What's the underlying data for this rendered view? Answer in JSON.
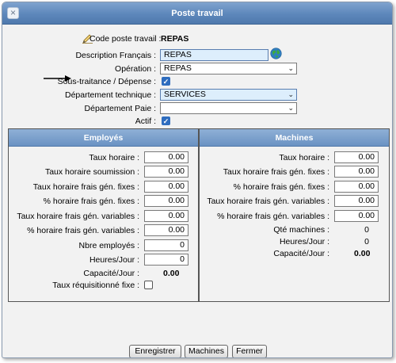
{
  "window": {
    "title": "Poste travail",
    "close_glyph": "×"
  },
  "form": {
    "code_label": "Code poste travail :",
    "code_value": "REPAS",
    "description_label": "Description Français :",
    "description_value": "REPAS",
    "operation_label": "Opération :",
    "operation_value": "REPAS",
    "soustraitance_label": "Sous-traitance / Dépense :",
    "soustraitance_checked": true,
    "dept_tech_label": "Département technique :",
    "dept_tech_value": "SERVICES",
    "dept_paie_label": "Département Paie :",
    "dept_paie_value": "",
    "actif_label": "Actif :",
    "actif_checked": true
  },
  "icons": {
    "edit": "pencil-icon",
    "globe": "globe-icon",
    "arrow": "arrow-right-icon",
    "chevron": "chevron-down-icon"
  },
  "employes": {
    "title": "Employés",
    "taux_horaire_label": "Taux horaire :",
    "taux_horaire_value": "0.00",
    "taux_soum_label": "Taux horaire soumission :",
    "taux_soum_value": "0.00",
    "fixes_label": "Taux horaire frais gén. fixes :",
    "fixes_value": "0.00",
    "pct_fixes_label": "% horaire frais gén. fixes :",
    "pct_fixes_value": "0.00",
    "variables_label": "Taux horaire frais gén. variables :",
    "variables_value": "0.00",
    "pct_variables_label": "% horaire frais gén. variables :",
    "pct_variables_value": "0.00",
    "nbre_label": "Nbre employés :",
    "nbre_value": "0",
    "heures_label": "Heures/Jour :",
    "heures_value": "0",
    "capacite_label": "Capacité/Jour :",
    "capacite_value": "0.00",
    "requisition_label": "Taux réquisitionné fixe :",
    "requisition_checked": false
  },
  "machines": {
    "title": "Machines",
    "taux_horaire_label": "Taux horaire :",
    "taux_horaire_value": "0.00",
    "fixes_label": "Taux horaire frais gén. fixes :",
    "fixes_value": "0.00",
    "pct_fixes_label": "% horaire frais gén. fixes :",
    "pct_fixes_value": "0.00",
    "variables_label": "Taux horaire frais gén. variables :",
    "variables_value": "0.00",
    "pct_variables_label": "% horaire frais gén. variables :",
    "pct_variables_value": "0.00",
    "qte_label": "Qté machines :",
    "qte_value": "0",
    "heures_label": "Heures/Jour :",
    "heures_value": "0",
    "capacite_label": "Capacité/Jour :",
    "capacite_value": "0.00"
  },
  "buttons": {
    "save": "Enregistrer",
    "machines": "Machines",
    "close": "Fermer"
  },
  "colors": {
    "title_bar": "#5d87bb",
    "panel_header": "#6a92c3",
    "checkbox": "#2f6dbf",
    "input_highlight": "#ddeefc"
  }
}
